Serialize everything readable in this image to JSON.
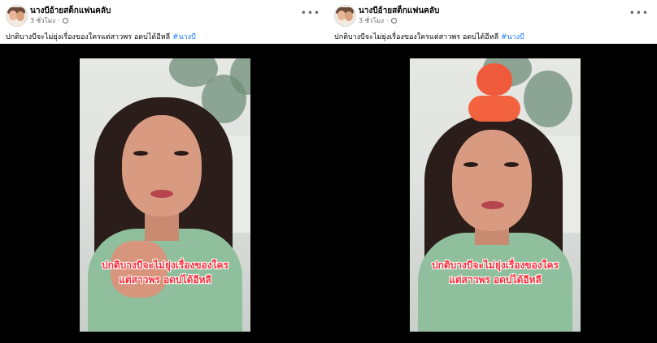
{
  "posts": [
    {
      "page_name": "นางบีอ้ายสต็กแฟนคลับ",
      "time": "3 ชั่วโมง",
      "caption": "ปกติบางบีจะไม่ยุ่งเรื่องของใครแต่สาวพร  อดบ่ได้อีหลี",
      "hashtag": "#นางบี",
      "video_line1": "ปกติบางบีจะไม่ยุ่งเรื่องของใคร",
      "video_line2": "แต่สาวพร อดบ่ได้อีหลี",
      "more_label": "•••"
    },
    {
      "page_name": "นางบีอ้ายสต็กแฟนคลับ",
      "time": "3 ชั่วโมง",
      "caption": "ปกติบางบีจะไม่ยุ่งเรื่องของใครแต่สาวพร  อดบ่ได้อีหลี",
      "hashtag": "#นางบี",
      "video_line1": "ปกติบางบีจะไม่ยุ่งเรื่องของใคร",
      "video_line2": "แต่สาวพร อดบ่ได้อีหลี",
      "more_label": "•••"
    }
  ],
  "colors": {
    "hashtag": "#1877f2",
    "overlay_text": "#ff2d3a",
    "video_bg": "#000000"
  },
  "icons": {
    "globe": "globe-icon",
    "more": "more-options-icon"
  }
}
